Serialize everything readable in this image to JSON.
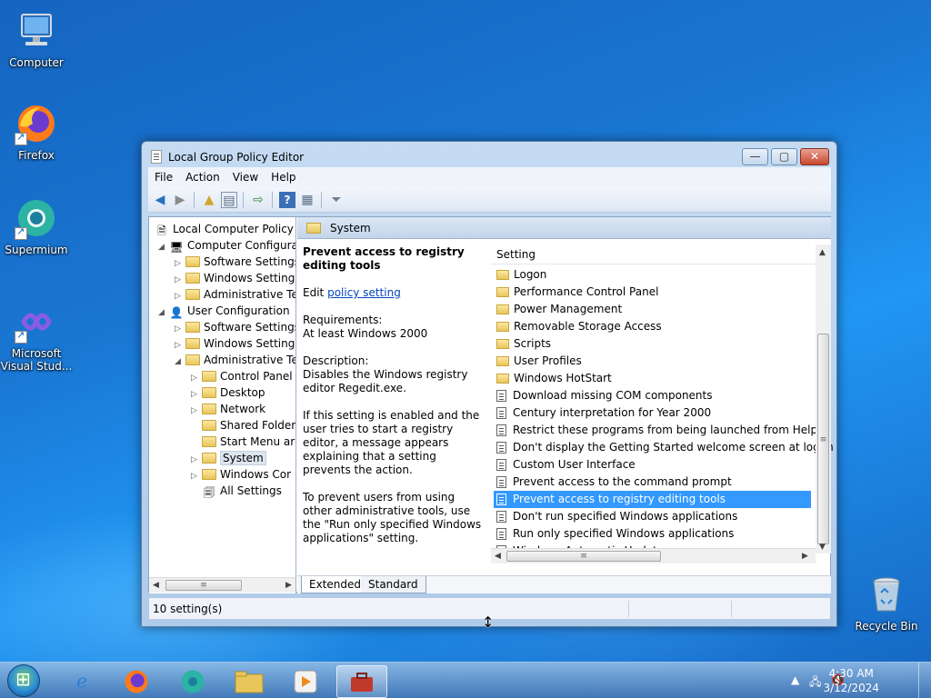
{
  "desktop": {
    "icons": [
      {
        "label": "Computer"
      },
      {
        "label": "Firefox"
      },
      {
        "label": "Supermium"
      },
      {
        "label": "Microsoft Visual Stud..."
      },
      {
        "label": "Recycle Bin"
      }
    ]
  },
  "window": {
    "title": "Local Group Policy Editor",
    "controls": {
      "minimize": "—",
      "maximize": "▢",
      "close": "✕"
    },
    "menu": [
      "File",
      "Action",
      "View",
      "Help"
    ],
    "tree": [
      {
        "label": "Local Computer Policy"
      },
      {
        "label": "Computer Configura"
      },
      {
        "label": "Software Settings"
      },
      {
        "label": "Windows Setting"
      },
      {
        "label": "Administrative Te"
      },
      {
        "label": "User Configuration"
      },
      {
        "label": "Software Settings"
      },
      {
        "label": "Windows Setting"
      },
      {
        "label": "Administrative Te"
      },
      {
        "label": "Control Panel"
      },
      {
        "label": "Desktop"
      },
      {
        "label": "Network"
      },
      {
        "label": "Shared Folder"
      },
      {
        "label": "Start Menu ar"
      },
      {
        "label": "System"
      },
      {
        "label": "Windows Cor"
      },
      {
        "label": "All Settings"
      }
    ],
    "pane_title": "System",
    "description": {
      "heading": "Prevent access to registry editing tools",
      "edit_prefix": "Edit",
      "edit_link": "policy setting",
      "requirements_label": "Requirements:",
      "requirements_value": "At least Windows 2000",
      "description_label": "Description:",
      "description_text": "Disables the Windows registry editor Regedit.exe.",
      "para2": "If this setting is enabled and the user tries to start a registry editor, a message appears explaining that a setting prevents the action.",
      "para3": "To prevent users from using other administrative tools, use the \"Run only specified Windows applications\" setting."
    },
    "list": {
      "column": "Setting",
      "items": [
        {
          "label": "Logon",
          "type": "folder"
        },
        {
          "label": "Performance Control Panel",
          "type": "folder"
        },
        {
          "label": "Power Management",
          "type": "folder"
        },
        {
          "label": "Removable Storage Access",
          "type": "folder"
        },
        {
          "label": "Scripts",
          "type": "folder"
        },
        {
          "label": "User Profiles",
          "type": "folder"
        },
        {
          "label": "Windows HotStart",
          "type": "folder"
        },
        {
          "label": "Download missing COM components",
          "type": "policy"
        },
        {
          "label": "Century interpretation for Year 2000",
          "type": "policy"
        },
        {
          "label": "Restrict these programs from being launched from Help",
          "type": "policy"
        },
        {
          "label": "Don't display the Getting Started welcome screen at logon",
          "type": "policy"
        },
        {
          "label": "Custom User Interface",
          "type": "policy"
        },
        {
          "label": "Prevent access to the command prompt",
          "type": "policy"
        },
        {
          "label": "Prevent access to registry editing tools",
          "type": "policy",
          "selected": true
        },
        {
          "label": "Don't run specified Windows applications",
          "type": "policy"
        },
        {
          "label": "Run only specified Windows applications",
          "type": "policy"
        },
        {
          "label": "Windows Automatic Updates",
          "type": "policy"
        }
      ]
    },
    "tabs": [
      "Extended",
      "Standard"
    ],
    "status": "10 setting(s)"
  },
  "taskbar": {
    "time": "4:30 AM",
    "date": "3/12/2024"
  },
  "colors": {
    "selection": "#3399ff",
    "link": "#0645c0"
  }
}
